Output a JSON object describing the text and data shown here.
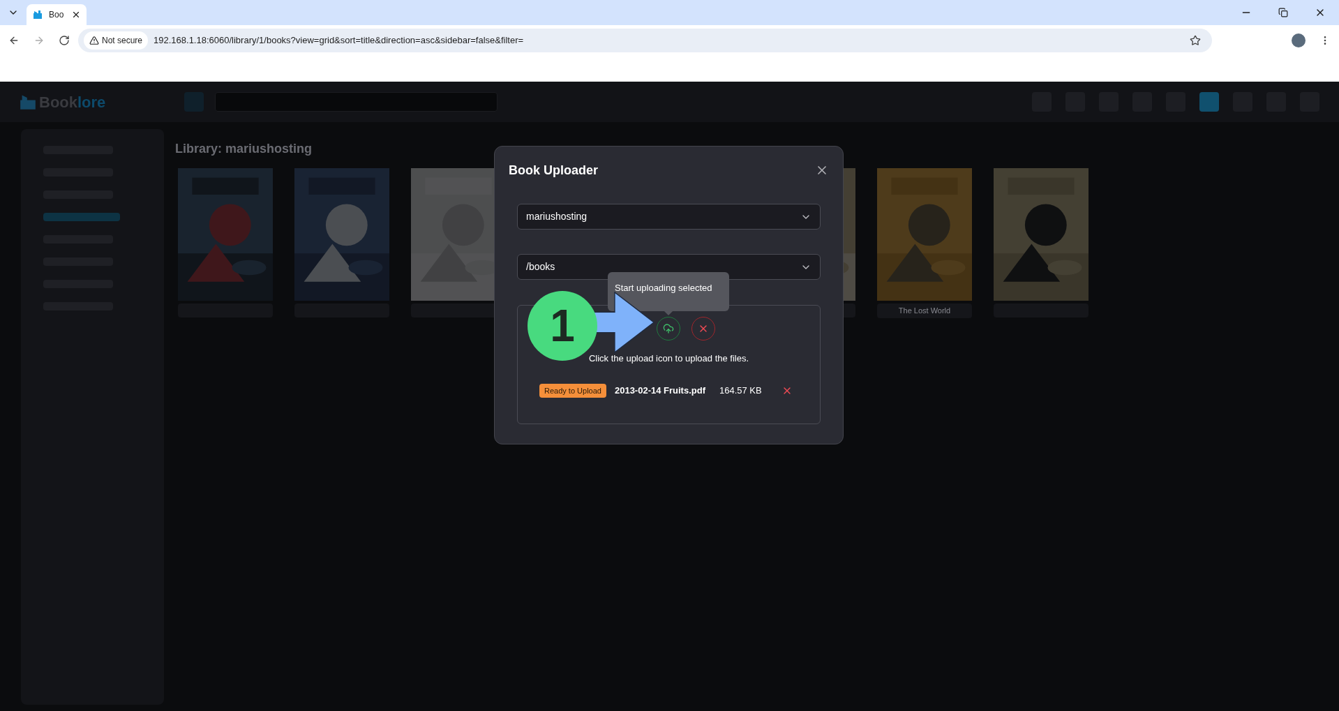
{
  "browser": {
    "tab_title": "Boo",
    "security": "Not secure",
    "url": "192.168.1.18:6060/library/1/books?view=grid&sort=title&direction=asc&sidebar=false&filter="
  },
  "app": {
    "logo_primary": "Book",
    "logo_secondary": "lore",
    "library_heading": "Library: mariushosting",
    "book_caption": "The Lost World"
  },
  "dialog": {
    "title": "Book Uploader",
    "library_select": "mariushosting",
    "path_select": "/books",
    "tooltip": "Start uploading selected",
    "hint": "Click the upload icon to upload the files.",
    "files": [
      {
        "status": "Ready to Upload",
        "name": "2013-02-14 Fruits.pdf",
        "size": "164.57 KB"
      }
    ]
  },
  "annotation": {
    "step_marker": "1"
  },
  "sidebar": {
    "items": [
      {
        "selected": false
      },
      {
        "selected": false
      },
      {
        "selected": false
      },
      {
        "selected": true
      },
      {
        "selected": false
      },
      {
        "selected": false
      },
      {
        "selected": false
      },
      {
        "selected": false
      }
    ]
  }
}
